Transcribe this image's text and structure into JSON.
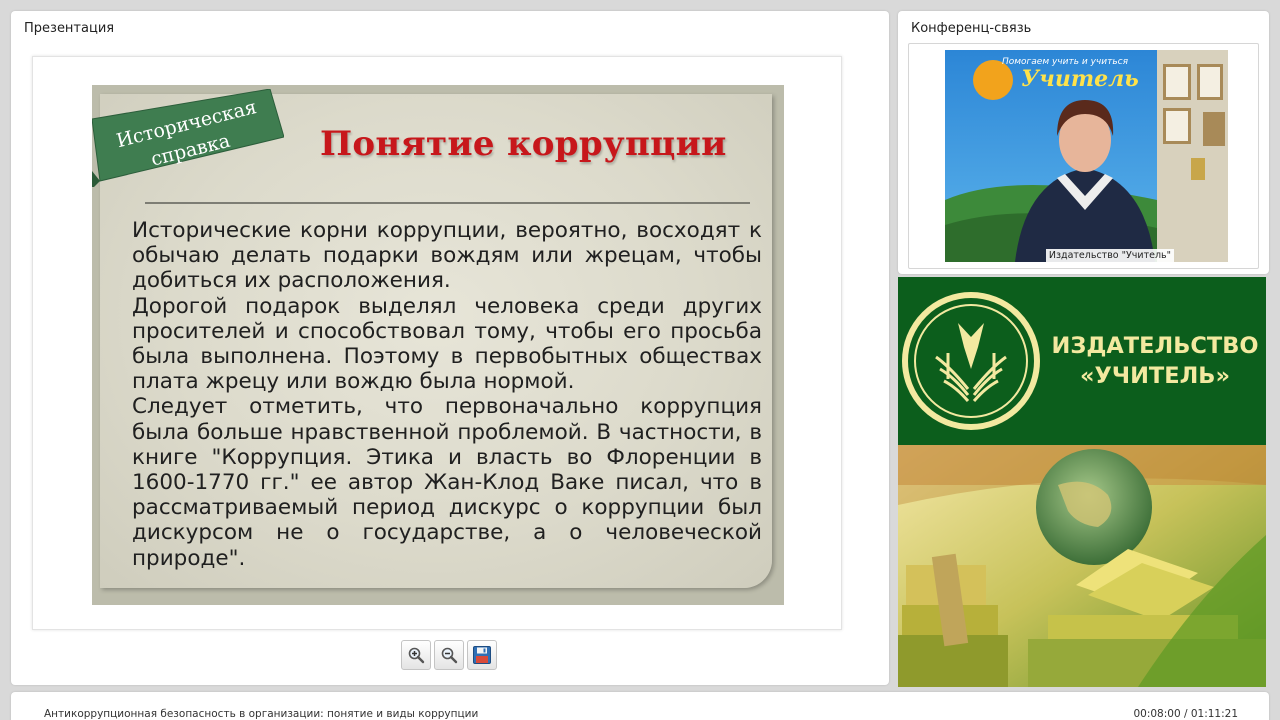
{
  "presentation": {
    "title": "Презентация",
    "slide": {
      "ribbon_line1": "Историческая",
      "ribbon_line2": "справка",
      "title": "Понятие коррупции",
      "paragraphs": [
        "Исторические корни коррупции, вероятно, восходят к обычаю делать подарки вождям или жрецам, чтобы добиться их расположения.",
        "Дорогой подарок выделял человека среди других просителей и способствовал тому, чтобы его просьба была выполнена. Поэтому в первобытных обществах плата жрецу или вождю была нормой.",
        "Следует отметить, что первоначально коррупция была больше нравственной проблемой. В частности, в книге \"Коррупция. Этика и власть во Флоренции в 1600-1770 гг.\" ее автор Жан-Клод Ваке писал, что в рассматриваемый период дискурс о коррупции был дискурсом не о государстве, а о человеческой природе\"."
      ]
    },
    "toolbar": {
      "zoom_in_icon": "zoom-in-icon",
      "zoom_out_icon": "zoom-out-icon",
      "save_icon": "floppy-disk-icon"
    }
  },
  "conference": {
    "title": "Конференц-связь",
    "video_caption": "Издательство \"Учитель\"",
    "video_sign_line1": "Помогаем учить и учиться",
    "video_sign_brand": "Учитель"
  },
  "banner": {
    "line1": "ИЗДАТЕЛЬСТВО",
    "line2": "«УЧИТЕЛЬ»"
  },
  "status": {
    "title": "Антикоррупционная безопасность в организации: понятие и виды коррупции",
    "time": "00:08:00 / 01:11:21"
  },
  "colors": {
    "slide_title": "#c7171b",
    "ribbon": "#3f7d50",
    "banner_green": "#0c5e1c",
    "banner_text": "#f3e9a0"
  }
}
